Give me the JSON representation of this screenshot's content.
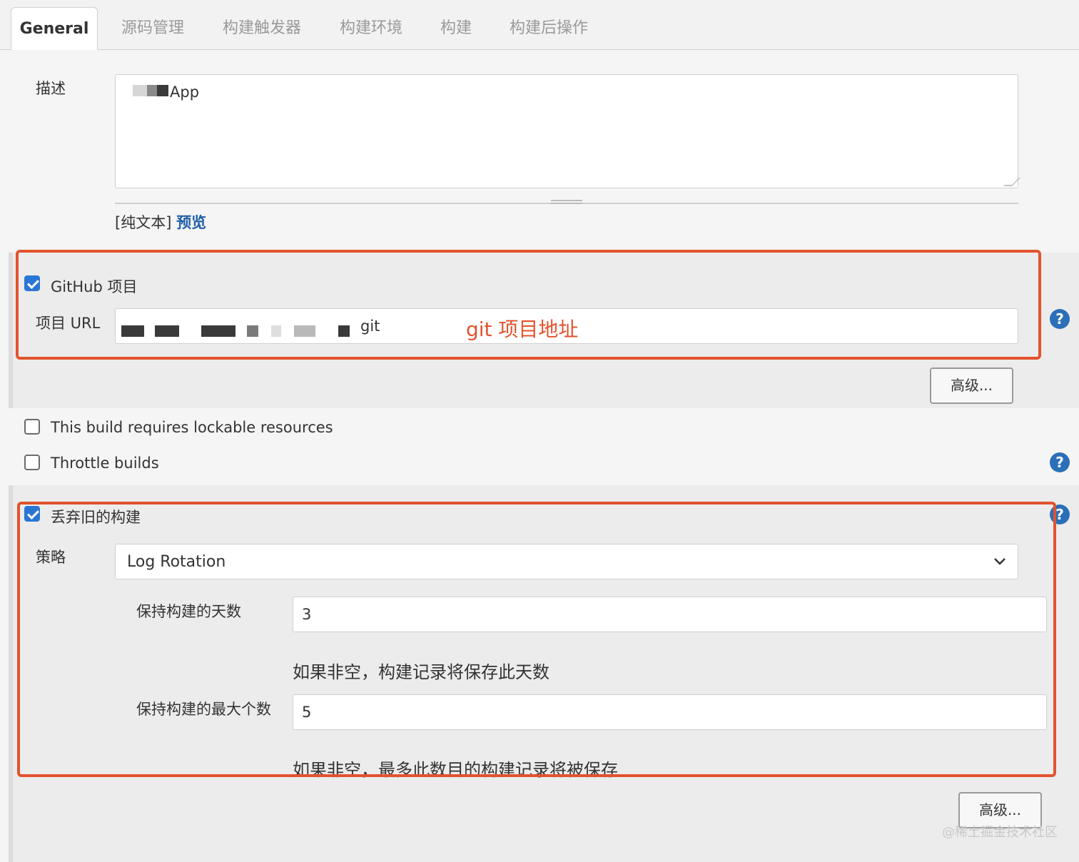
{
  "tabs": [
    {
      "label": "General",
      "active": true
    },
    {
      "label": "源码管理"
    },
    {
      "label": "构建触发器"
    },
    {
      "label": "构建环境"
    },
    {
      "label": "构建"
    },
    {
      "label": "构建后操作"
    }
  ],
  "description": {
    "label": "描述",
    "value_visible": "App",
    "format_label": "[纯文本]",
    "preview_link": "预览"
  },
  "github": {
    "checkbox_label": "GitHub 项目",
    "checked": true,
    "url_label": "项目 URL",
    "url_suffix": "git",
    "annotation": "git 项目地址",
    "advanced_button": "高级..."
  },
  "lockable": {
    "label": "This build requires lockable resources",
    "checked": false
  },
  "throttle": {
    "label": "Throttle builds",
    "checked": false
  },
  "discard": {
    "label": "丢弃旧的构建",
    "checked": true,
    "strategy_label": "策略",
    "strategy_value": "Log Rotation",
    "days_label": "保持构建的天数",
    "days_value": "3",
    "days_hint": "如果非空，构建记录将保存此天数",
    "max_label": "保持构建的最大个数",
    "max_value": "5",
    "max_hint": "如果非空，最多此数目的构建记录将被保存",
    "advanced_button": "高级..."
  },
  "help_icon_text": "?",
  "watermark": "@稀土掘金技术社区",
  "colors": {
    "annotation_red": "#e2532d",
    "checkbox_blue": "#2b76d4",
    "link_blue": "#1f5fa6",
    "help_blue": "#2a6fb8"
  }
}
